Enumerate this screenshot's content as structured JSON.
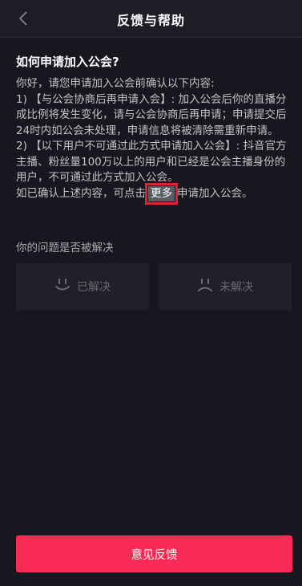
{
  "header": {
    "title": "反馈与帮助",
    "back_icon": "chevron-left-icon"
  },
  "question": {
    "title": "如何申请加入公会?",
    "paragraphs": [
      "你好，请您申请加入公会前确认以下内容:",
      "1) 【与公会协商后再申请入会】: 加入公会后你的直播分成比例将发生变化，请与公会协商后再申请；申请提交后24时内如公会未处理，申请信息将被清除需重新申请。",
      "2) 【以下用户不可通过此方式申请加入公会】: 抖音官方主播、粉丝量100万以上的用户和已经是公会主播身份的用户，不可通过此方式加入公会。"
    ],
    "final_prefix": "如已确认上述内容，可点击",
    "more_link": "更多",
    "final_suffix": "申请加入公会。"
  },
  "resolve": {
    "question": "你的问题是否被解决",
    "solved_label": "已解决",
    "solved_icon": "smile-face-icon",
    "unsolved_label": "未解决",
    "unsolved_icon": "sad-face-icon"
  },
  "footer": {
    "feedback_label": "意见反馈"
  },
  "colors": {
    "background": "#16171f",
    "accent": "#fa2c55",
    "highlight_border": "#e3202b"
  }
}
